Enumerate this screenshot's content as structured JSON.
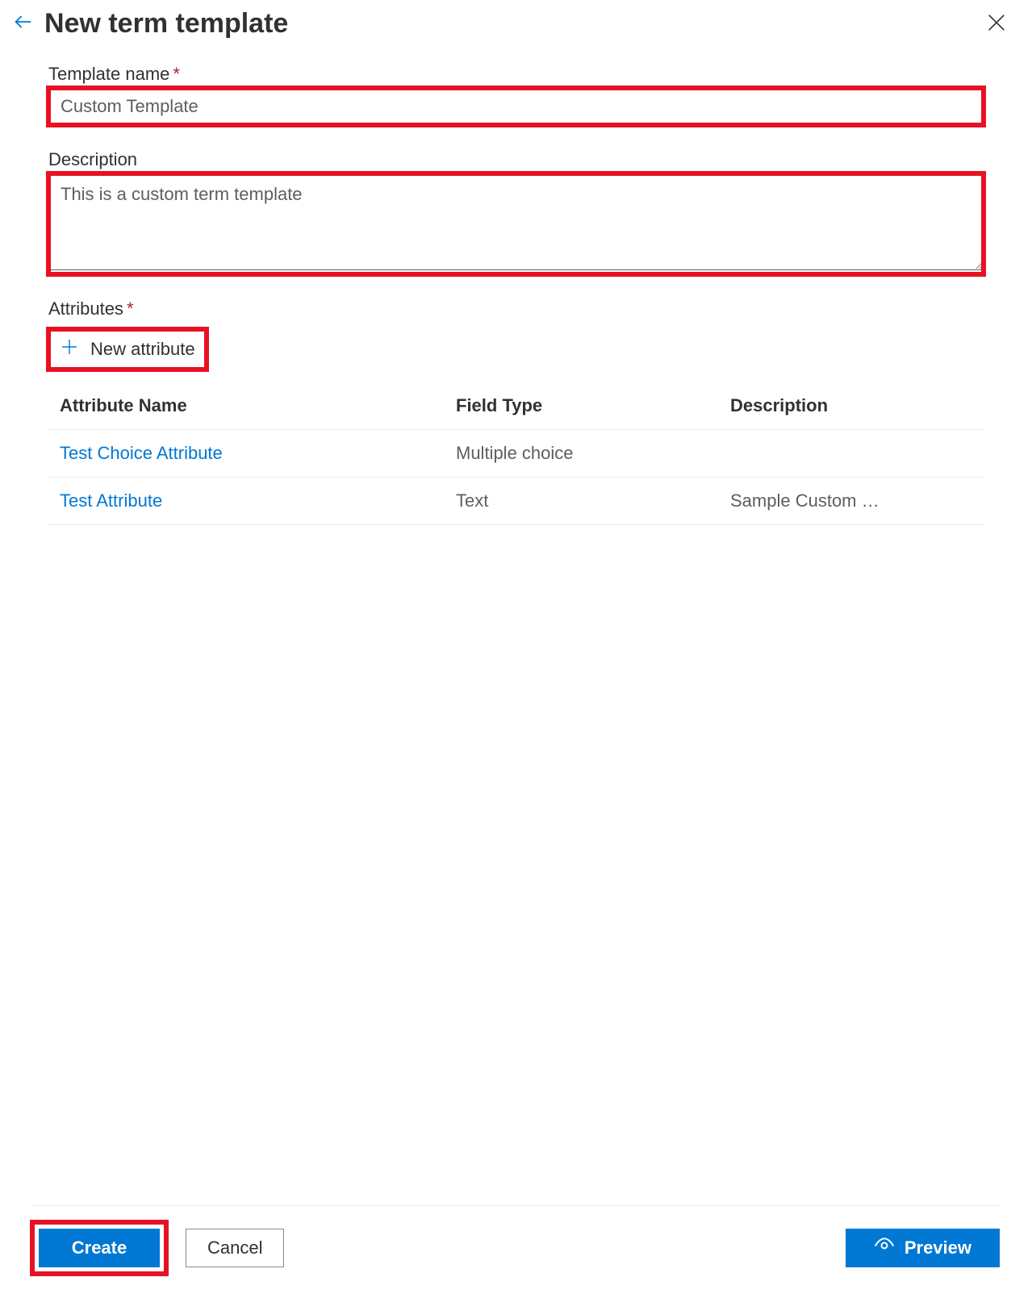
{
  "header": {
    "title": "New term template"
  },
  "form": {
    "templateName": {
      "label": "Template name",
      "value": "Custom Template"
    },
    "description": {
      "label": "Description",
      "value": "This is a custom term template"
    },
    "attributes": {
      "label": "Attributes",
      "newAttribute": "New attribute",
      "columns": {
        "name": "Attribute Name",
        "fieldType": "Field Type",
        "description": "Description"
      },
      "rows": [
        {
          "name": "Test Choice Attribute",
          "fieldType": "Multiple choice",
          "description": ""
        },
        {
          "name": "Test Attribute",
          "fieldType": "Text",
          "description": "Sample Custom …"
        }
      ]
    }
  },
  "footer": {
    "create": "Create",
    "cancel": "Cancel",
    "preview": "Preview"
  }
}
